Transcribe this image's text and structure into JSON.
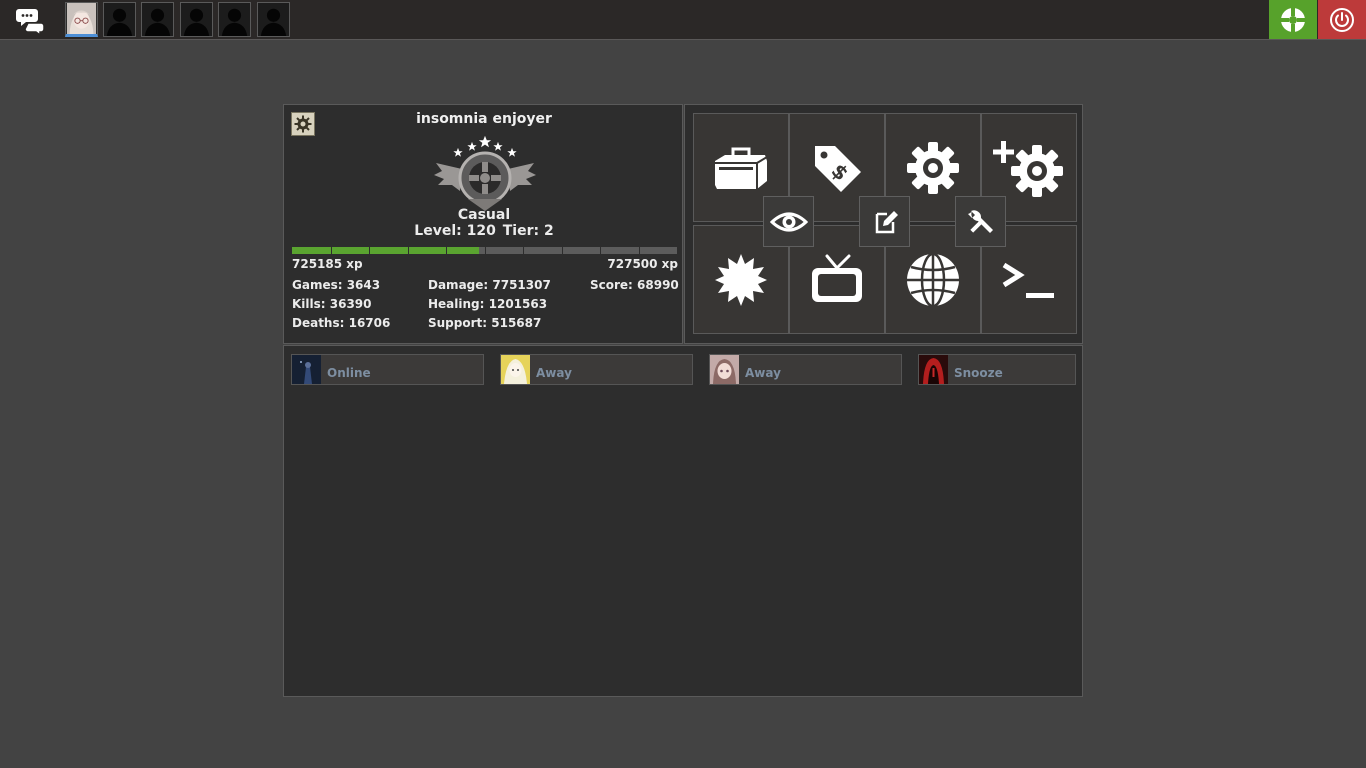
{
  "topbar": {
    "party_slots": [
      {
        "kind": "avatar",
        "active": true
      },
      {
        "kind": "empty"
      },
      {
        "kind": "empty"
      },
      {
        "kind": "empty"
      },
      {
        "kind": "empty"
      },
      {
        "kind": "empty"
      }
    ],
    "icons": {
      "chat": "chat-bubbles-icon",
      "menu": "tf2-logo-icon",
      "quit": "power-icon"
    },
    "colors": {
      "menu": "#57a22b",
      "quit": "#bd3a3a",
      "active_slot": "#4d8fd6"
    }
  },
  "profile": {
    "username": "insomnia enjoyer",
    "rank_name": "Casual",
    "level_text": "Level: 120",
    "tier_text": "Tier: 2",
    "xp_current": "725185 xp",
    "xp_next": "727500 xp",
    "xp_progress": 0.487,
    "stats": {
      "games": "Games: 3643",
      "kills": "Kills: 36390",
      "deaths": "Deaths: 16706",
      "damage": "Damage: 7751307",
      "healing": "Healing: 1201563",
      "support": "Support: 515687",
      "score": "Score: 68990"
    },
    "icons": {
      "settings": "gear-icon",
      "rank": "rank-emblem-icon"
    }
  },
  "tools": {
    "large": [
      "toolbox-icon",
      "price-tag-icon",
      "gear-icon",
      "add-gear-icon",
      "burst-icon",
      "tv-icon",
      "globe-icon",
      "console-icon"
    ],
    "small": [
      "eye-icon",
      "edit-icon",
      "wrench-icon"
    ]
  },
  "friends": [
    {
      "status": "Online",
      "avatar": "night-figure"
    },
    {
      "status": "Away",
      "avatar": "blonde-anime"
    },
    {
      "status": "Away",
      "avatar": "brown-hair-anime"
    },
    {
      "status": "Snooze",
      "avatar": "red-hood"
    }
  ]
}
